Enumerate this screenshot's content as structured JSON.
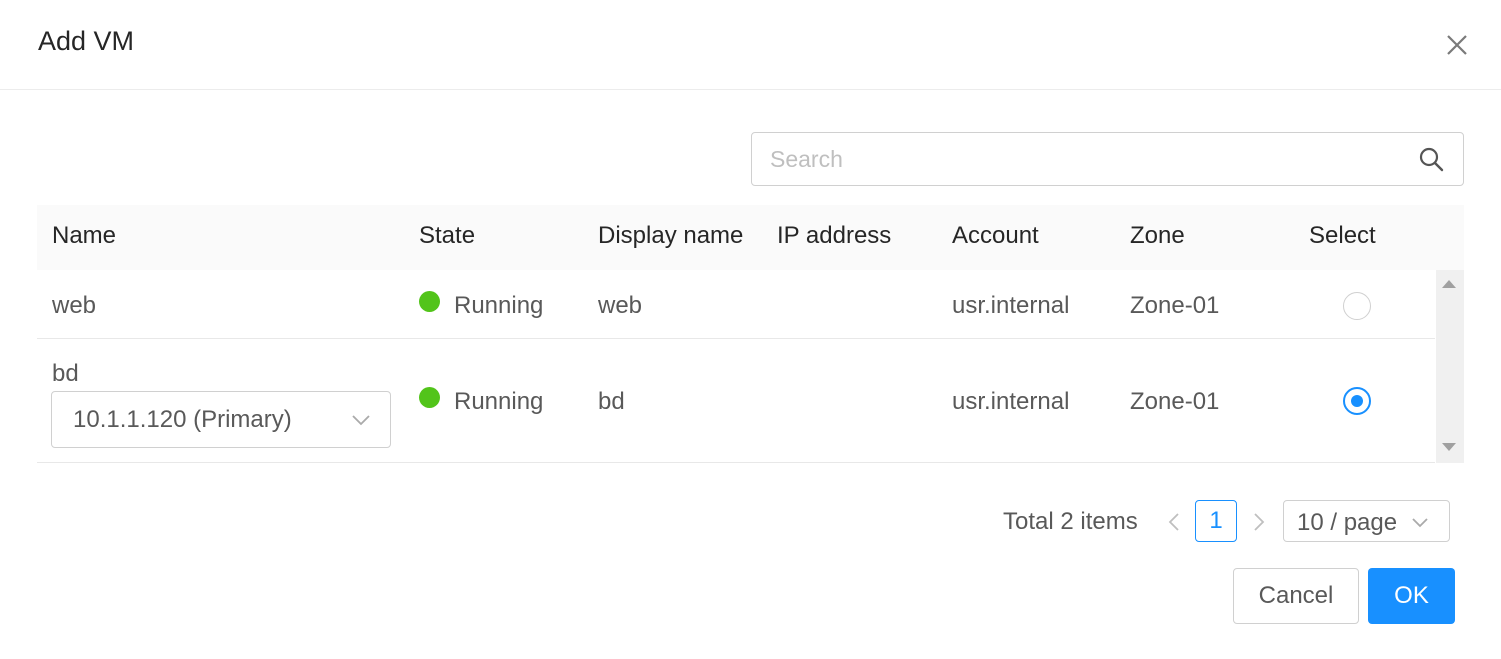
{
  "dialog": {
    "title": "Add VM",
    "close_icon": "close-icon"
  },
  "search": {
    "placeholder": "Search",
    "value": "",
    "icon": "search-icon"
  },
  "table": {
    "columns": [
      "Name",
      "State",
      "Display name",
      "IP address",
      "Account",
      "Zone",
      "Select"
    ],
    "rows": [
      {
        "name": "web",
        "state": "Running",
        "state_color": "#52c41a",
        "display_name": "web",
        "ip_address": "",
        "account": "usr.internal",
        "zone": "Zone-01",
        "selected": false
      },
      {
        "name": "bd",
        "nic_select": "10.1.1.120 (Primary)",
        "state": "Running",
        "state_color": "#52c41a",
        "display_name": "bd",
        "ip_address": "",
        "account": "usr.internal",
        "zone": "Zone-01",
        "selected": true
      }
    ]
  },
  "pagination": {
    "total_text": "Total 2 items",
    "current_page": "1",
    "page_size": "10 / page"
  },
  "footer": {
    "cancel_label": "Cancel",
    "ok_label": "OK"
  },
  "colors": {
    "primary": "#1890ff",
    "success": "#52c41a"
  }
}
